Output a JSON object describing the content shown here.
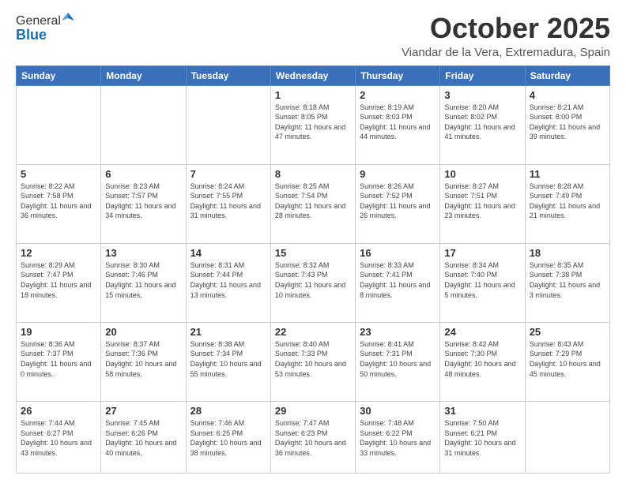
{
  "logo": {
    "general": "General",
    "blue": "Blue"
  },
  "header": {
    "month": "October 2025",
    "location": "Viandar de la Vera, Extremadura, Spain"
  },
  "weekdays": [
    "Sunday",
    "Monday",
    "Tuesday",
    "Wednesday",
    "Thursday",
    "Friday",
    "Saturday"
  ],
  "weeks": [
    [
      {
        "day": "",
        "info": ""
      },
      {
        "day": "",
        "info": ""
      },
      {
        "day": "",
        "info": ""
      },
      {
        "day": "1",
        "info": "Sunrise: 8:18 AM\nSunset: 8:05 PM\nDaylight: 11 hours and 47 minutes."
      },
      {
        "day": "2",
        "info": "Sunrise: 8:19 AM\nSunset: 8:03 PM\nDaylight: 11 hours and 44 minutes."
      },
      {
        "day": "3",
        "info": "Sunrise: 8:20 AM\nSunset: 8:02 PM\nDaylight: 11 hours and 41 minutes."
      },
      {
        "day": "4",
        "info": "Sunrise: 8:21 AM\nSunset: 8:00 PM\nDaylight: 11 hours and 39 minutes."
      }
    ],
    [
      {
        "day": "5",
        "info": "Sunrise: 8:22 AM\nSunset: 7:58 PM\nDaylight: 11 hours and 36 minutes."
      },
      {
        "day": "6",
        "info": "Sunrise: 8:23 AM\nSunset: 7:57 PM\nDaylight: 11 hours and 34 minutes."
      },
      {
        "day": "7",
        "info": "Sunrise: 8:24 AM\nSunset: 7:55 PM\nDaylight: 11 hours and 31 minutes."
      },
      {
        "day": "8",
        "info": "Sunrise: 8:25 AM\nSunset: 7:54 PM\nDaylight: 11 hours and 28 minutes."
      },
      {
        "day": "9",
        "info": "Sunrise: 8:26 AM\nSunset: 7:52 PM\nDaylight: 11 hours and 26 minutes."
      },
      {
        "day": "10",
        "info": "Sunrise: 8:27 AM\nSunset: 7:51 PM\nDaylight: 11 hours and 23 minutes."
      },
      {
        "day": "11",
        "info": "Sunrise: 8:28 AM\nSunset: 7:49 PM\nDaylight: 11 hours and 21 minutes."
      }
    ],
    [
      {
        "day": "12",
        "info": "Sunrise: 8:29 AM\nSunset: 7:47 PM\nDaylight: 11 hours and 18 minutes."
      },
      {
        "day": "13",
        "info": "Sunrise: 8:30 AM\nSunset: 7:46 PM\nDaylight: 11 hours and 15 minutes."
      },
      {
        "day": "14",
        "info": "Sunrise: 8:31 AM\nSunset: 7:44 PM\nDaylight: 11 hours and 13 minutes."
      },
      {
        "day": "15",
        "info": "Sunrise: 8:32 AM\nSunset: 7:43 PM\nDaylight: 11 hours and 10 minutes."
      },
      {
        "day": "16",
        "info": "Sunrise: 8:33 AM\nSunset: 7:41 PM\nDaylight: 11 hours and 8 minutes."
      },
      {
        "day": "17",
        "info": "Sunrise: 8:34 AM\nSunset: 7:40 PM\nDaylight: 11 hours and 5 minutes."
      },
      {
        "day": "18",
        "info": "Sunrise: 8:35 AM\nSunset: 7:38 PM\nDaylight: 11 hours and 3 minutes."
      }
    ],
    [
      {
        "day": "19",
        "info": "Sunrise: 8:36 AM\nSunset: 7:37 PM\nDaylight: 11 hours and 0 minutes."
      },
      {
        "day": "20",
        "info": "Sunrise: 8:37 AM\nSunset: 7:36 PM\nDaylight: 10 hours and 58 minutes."
      },
      {
        "day": "21",
        "info": "Sunrise: 8:38 AM\nSunset: 7:34 PM\nDaylight: 10 hours and 55 minutes."
      },
      {
        "day": "22",
        "info": "Sunrise: 8:40 AM\nSunset: 7:33 PM\nDaylight: 10 hours and 53 minutes."
      },
      {
        "day": "23",
        "info": "Sunrise: 8:41 AM\nSunset: 7:31 PM\nDaylight: 10 hours and 50 minutes."
      },
      {
        "day": "24",
        "info": "Sunrise: 8:42 AM\nSunset: 7:30 PM\nDaylight: 10 hours and 48 minutes."
      },
      {
        "day": "25",
        "info": "Sunrise: 8:43 AM\nSunset: 7:29 PM\nDaylight: 10 hours and 45 minutes."
      }
    ],
    [
      {
        "day": "26",
        "info": "Sunrise: 7:44 AM\nSunset: 6:27 PM\nDaylight: 10 hours and 43 minutes."
      },
      {
        "day": "27",
        "info": "Sunrise: 7:45 AM\nSunset: 6:26 PM\nDaylight: 10 hours and 40 minutes."
      },
      {
        "day": "28",
        "info": "Sunrise: 7:46 AM\nSunset: 6:25 PM\nDaylight: 10 hours and 38 minutes."
      },
      {
        "day": "29",
        "info": "Sunrise: 7:47 AM\nSunset: 6:23 PM\nDaylight: 10 hours and 36 minutes."
      },
      {
        "day": "30",
        "info": "Sunrise: 7:48 AM\nSunset: 6:22 PM\nDaylight: 10 hours and 33 minutes."
      },
      {
        "day": "31",
        "info": "Sunrise: 7:50 AM\nSunset: 6:21 PM\nDaylight: 10 hours and 31 minutes."
      },
      {
        "day": "",
        "info": ""
      }
    ]
  ]
}
